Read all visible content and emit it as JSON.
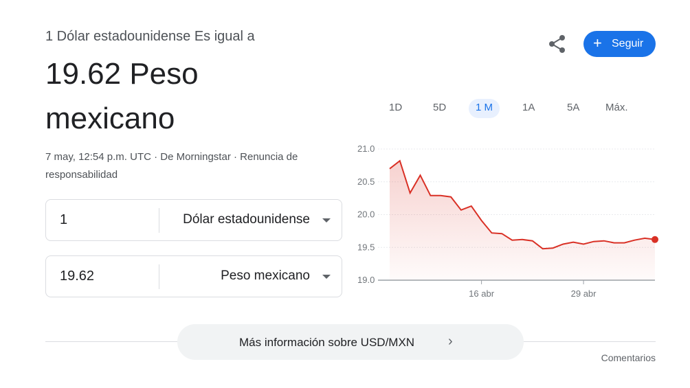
{
  "header": {
    "subtitle": "1 Dólar estadounidense Es igual a",
    "value_line1": "19.62 Peso",
    "value_line2": "mexicano",
    "meta_line1": "7 may, 12:54 p.m. UTC · De Morningstar · Renuncia de",
    "meta_line2": "responsabilidad"
  },
  "actions": {
    "share_icon": "share-icon",
    "follow_label": "Seguir",
    "follow_icon": "+",
    "accent": "#1a73e8"
  },
  "converter": {
    "from_amount": "1",
    "from_currency": "Dólar estadounidense",
    "to_amount": "19.62",
    "to_currency": "Peso mexicano"
  },
  "ranges": [
    "1D",
    "5D",
    "1 M",
    "1A",
    "5A",
    "Máx."
  ],
  "active_range": "1 M",
  "chart_data": {
    "type": "line",
    "color": "#d93025",
    "ylim": [
      19.0,
      21.0
    ],
    "y_ticks": [
      "21.0",
      "20.5",
      "20.0",
      "19.5",
      "19.0"
    ],
    "x_tick_labels": [
      "16 abr",
      "29 abr"
    ],
    "values": [
      20.7,
      20.82,
      20.33,
      20.6,
      20.29,
      20.29,
      20.27,
      20.07,
      20.13,
      19.91,
      19.72,
      19.71,
      19.61,
      19.62,
      19.6,
      19.48,
      19.49,
      19.55,
      19.58,
      19.55,
      19.59,
      19.6,
      19.57,
      19.57,
      19.61,
      19.64,
      19.62
    ],
    "x_tick_indices": [
      9,
      19
    ],
    "last_value": 19.62
  },
  "more_info": {
    "label": "Más información sobre USD/MXN",
    "chevron": "›"
  },
  "feedback": "Comentarios"
}
